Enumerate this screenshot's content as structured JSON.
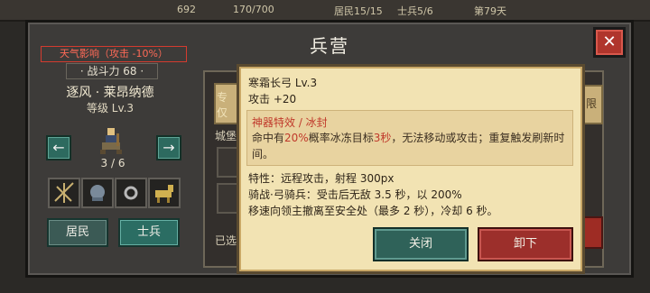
{
  "topbar": {
    "gold": "692",
    "resource2": "170/700",
    "residents": "居民15/15",
    "soldiers": "士兵5/6",
    "day": "第79天"
  },
  "panel": {
    "title": "兵营",
    "close_label": "✕"
  },
  "hero": {
    "weather_effect": "天气影响（攻击 -10%）",
    "power": "· 战斗力 68 ·",
    "name": "逐风 · 莱昂纳德",
    "level": "等级 Lv.3",
    "count": "3 / 6",
    "prev_label": "←",
    "next_label": "→"
  },
  "tabs": {
    "residents": "居民",
    "soldiers": "士兵"
  },
  "behind": {
    "label1": "专",
    "label1b": "仅",
    "label2": "城堡",
    "label3": "已选",
    "right": "限"
  },
  "tooltip": {
    "title": "寒霜长弓 Lv.3",
    "attack": "攻击 +20",
    "effect_title": "神器特效 / 冰封",
    "effect_pre": "命中有",
    "effect_pct": "20%",
    "effect_mid": "概率冰冻目标",
    "effect_sec": "3秒",
    "effect_post": "，无法移动或攻击；重复触发刷新时间。",
    "trait1": "特性：远程攻击，射程 300px",
    "trait2": "骑战·弓骑兵：受击后无敌 3.5 秒，以 200%",
    "trait3": "移速向领主撤离至安全处（最多 2 秒），冷却 6 秒。",
    "close_label": "关闭",
    "unequip_label": "卸下"
  },
  "colors": {
    "accent_teal": "#2f6259",
    "accent_red": "#9c2f2b",
    "tooltip_bg": "#f2e3b3",
    "highlight_red": "#c0392b"
  }
}
